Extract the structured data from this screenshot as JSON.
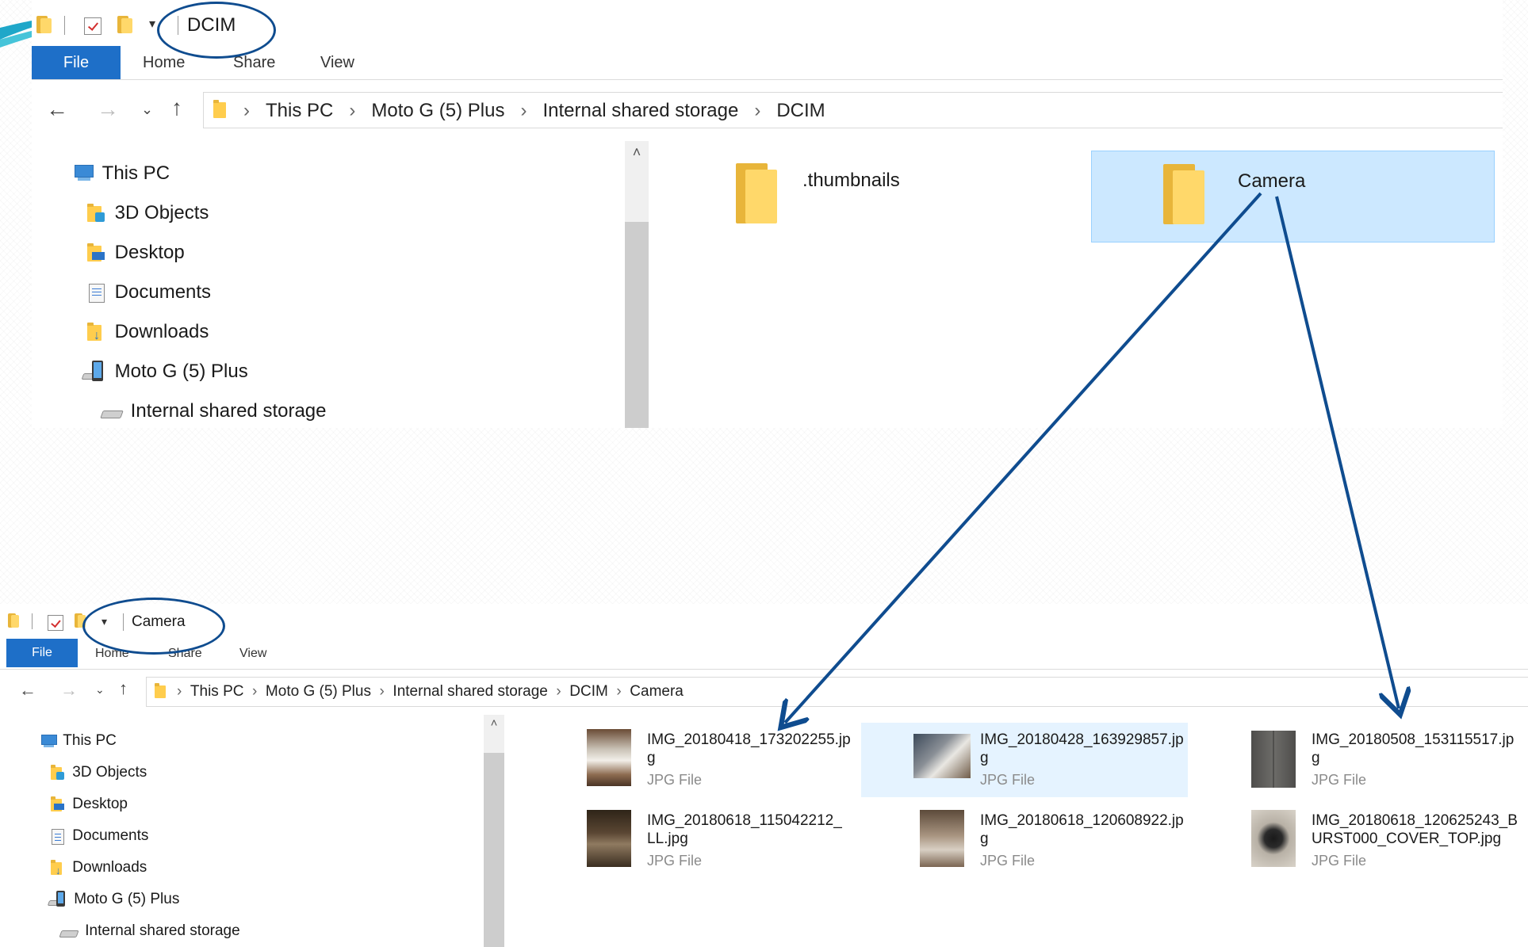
{
  "window_top": {
    "title": "DCIM",
    "ribbon": {
      "file": "File",
      "home": "Home",
      "share": "Share",
      "view": "View"
    },
    "breadcrumb": [
      "This PC",
      "Moto G (5) Plus",
      "Internal shared storage",
      "DCIM"
    ],
    "tree": {
      "this_pc": "This PC",
      "objects_3d": "3D Objects",
      "desktop": "Desktop",
      "documents": "Documents",
      "downloads": "Downloads",
      "device": "Moto G (5) Plus",
      "storage": "Internal shared storage"
    },
    "folders": [
      {
        "name": ".thumbnails",
        "selected": false
      },
      {
        "name": "Camera",
        "selected": true
      }
    ]
  },
  "window_bottom": {
    "title": "Camera",
    "ribbon": {
      "file": "File",
      "home": "Home",
      "share": "Share",
      "view": "View"
    },
    "breadcrumb": [
      "This PC",
      "Moto G (5) Plus",
      "Internal shared storage",
      "DCIM",
      "Camera"
    ],
    "tree": {
      "this_pc": "This PC",
      "objects_3d": "3D Objects",
      "desktop": "Desktop",
      "documents": "Documents",
      "downloads": "Downloads",
      "device": "Moto G (5) Plus",
      "storage": "Internal shared storage"
    },
    "files": [
      {
        "name": "IMG_20180418_173202255.jpg",
        "type": "JPG File",
        "selected": false
      },
      {
        "name": "IMG_20180428_163929857.jpg",
        "type": "JPG File",
        "selected": true
      },
      {
        "name": "IMG_20180508_153115517.jpg",
        "type": "JPG File",
        "selected": false
      },
      {
        "name": "IMG_20180618_115042212_LL.jpg",
        "type": "JPG File",
        "selected": false
      },
      {
        "name": "IMG_20180618_120608922.jpg",
        "type": "JPG File",
        "selected": false
      },
      {
        "name": "IMG_20180618_120625243_BURST000_COVER_TOP.jpg",
        "type": "JPG File",
        "selected": false
      }
    ]
  },
  "colors": {
    "file_tab": "#1e6fc8",
    "selection": "#cce8ff",
    "annotation": "#0f4c8f",
    "folder": "#ffd86a"
  },
  "icons": [
    "folder-icon",
    "checkmark-icon",
    "dropdown-icon",
    "back-arrow-icon",
    "forward-arrow-icon",
    "recent-chevron-icon",
    "up-arrow-icon",
    "this-pc-icon",
    "3d-objects-icon",
    "desktop-icon",
    "documents-icon",
    "downloads-icon",
    "phone-icon",
    "drive-icon"
  ]
}
